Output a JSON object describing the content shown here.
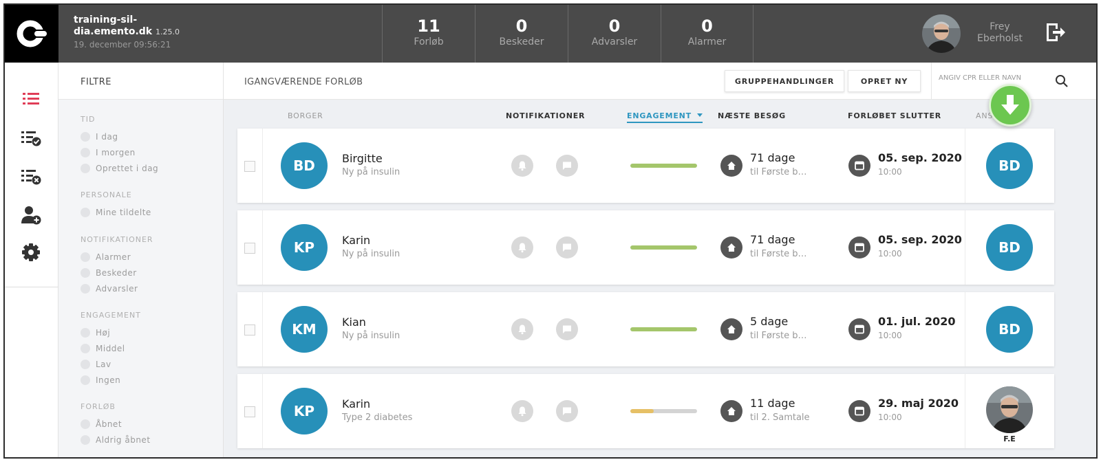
{
  "header": {
    "app_host": "training-sil-dia.emento.dk",
    "app_host_line1": "training-sil-",
    "app_host_line2": "dia.emento.dk",
    "version": "1.25.0",
    "datetime": "19. december 09:56:21",
    "stats": [
      {
        "value": "11",
        "label": "Forløb"
      },
      {
        "value": "0",
        "label": "Beskeder"
      },
      {
        "value": "0",
        "label": "Advarsler"
      },
      {
        "value": "0",
        "label": "Alarmer"
      }
    ],
    "user": {
      "first": "Frey",
      "last": "Eberholst"
    }
  },
  "rail": {
    "items": [
      {
        "icon": "list-icon",
        "color": "#e03d57"
      },
      {
        "icon": "list-check-icon"
      },
      {
        "icon": "list-x-icon"
      },
      {
        "icon": "add-user-icon"
      },
      {
        "icon": "gear-icon"
      }
    ]
  },
  "filters": {
    "title": "FILTRE",
    "groups": [
      {
        "title": "TID",
        "options": [
          "I dag",
          "I morgen",
          "Oprettet i dag"
        ]
      },
      {
        "title": "PERSONALE",
        "options": [
          "Mine tildelte"
        ]
      },
      {
        "title": "NOTIFIKATIONER",
        "options": [
          "Alarmer",
          "Beskeder",
          "Advarsler"
        ]
      },
      {
        "title": "ENGAGEMENT",
        "options": [
          "Høj",
          "Middel",
          "Lav",
          "Ingen"
        ]
      },
      {
        "title": "FORLØB",
        "options": [
          "Åbnet",
          "Aldrig åbnet"
        ]
      }
    ]
  },
  "main": {
    "title": "IGANGVÆRENDE FORLØB",
    "group_actions_label": "GRUPPEHANDLINGER",
    "create_new_label": "OPRET NY",
    "search_placeholder": "ANGIV CPR ELLER NAVN",
    "columns": {
      "citizen": "BORGER",
      "notifications": "NOTIFIKATIONER",
      "engagement": "ENGAGEMENT",
      "next_visit": "NÆSTE BESØG",
      "course_ends": "FORLØBET SLUTTER",
      "responsible": "ANS"
    }
  },
  "rows": [
    {
      "initials": "BD",
      "name": "Birgitte",
      "desc": "Ny på insulin",
      "engagement": 1.0,
      "engagement_color": "#a4c66b",
      "visit_days": "71 dage",
      "visit_to": "til Første b…",
      "end_date": "05. sep. 2020",
      "end_time": "10:00",
      "responsible": "BD"
    },
    {
      "initials": "KP",
      "name": "Karin",
      "desc": "Ny på insulin",
      "engagement": 1.0,
      "engagement_color": "#a4c66b",
      "visit_days": "71 dage",
      "visit_to": "til Første b…",
      "end_date": "05. sep. 2020",
      "end_time": "10:00",
      "responsible": "BD"
    },
    {
      "initials": "KM",
      "name": "Kian",
      "desc": "Ny på insulin",
      "engagement": 1.0,
      "engagement_color": "#a4c66b",
      "visit_days": "5 dage",
      "visit_to": "til Første b…",
      "end_date": "01. jul. 2020",
      "end_time": "10:00",
      "responsible": "BD"
    },
    {
      "initials": "KP",
      "name": "Karin",
      "desc": "Type 2 diabetes",
      "engagement": 0.35,
      "engagement_color": "#e6c066",
      "visit_days": "11 dage",
      "visit_to": "til 2. Samtale",
      "end_date": "29. maj 2020",
      "end_time": "10:00",
      "responsible": "F.E"
    }
  ]
}
